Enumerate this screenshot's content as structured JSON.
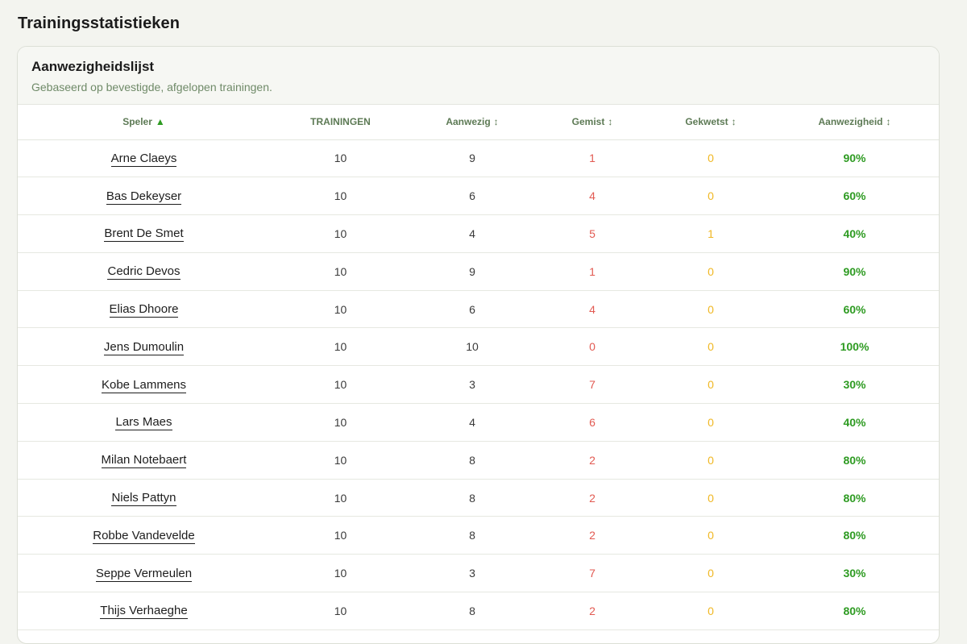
{
  "page": {
    "title": "Trainingsstatistieken"
  },
  "card": {
    "title": "Aanwezigheidslijst",
    "subtitle": "Gebaseerd op bevestigde, afgelopen trainingen."
  },
  "colors": {
    "missed": "#e25a52",
    "injured": "#f0b722",
    "percentage": "#2e9b22",
    "header_text": "#5d7a55"
  },
  "table": {
    "columns": [
      {
        "label": "Speler",
        "sort": "▲",
        "sort_active": true
      },
      {
        "label": "TRAININGEN",
        "sort": "",
        "sort_active": false
      },
      {
        "label": "Aanwezig",
        "sort": "↕",
        "sort_active": false
      },
      {
        "label": "Gemist",
        "sort": "↕",
        "sort_active": false
      },
      {
        "label": "Gekwetst",
        "sort": "↕",
        "sort_active": false
      },
      {
        "label": "Aanwezigheid",
        "sort": "↕",
        "sort_active": false
      }
    ],
    "rows": [
      {
        "player": "Arne Claeys",
        "trainings": "10",
        "present": "9",
        "missed": "1",
        "injured": "0",
        "attendance": "90%"
      },
      {
        "player": "Bas Dekeyser",
        "trainings": "10",
        "present": "6",
        "missed": "4",
        "injured": "0",
        "attendance": "60%"
      },
      {
        "player": "Brent De Smet",
        "trainings": "10",
        "present": "4",
        "missed": "5",
        "injured": "1",
        "attendance": "40%"
      },
      {
        "player": "Cedric Devos",
        "trainings": "10",
        "present": "9",
        "missed": "1",
        "injured": "0",
        "attendance": "90%"
      },
      {
        "player": "Elias Dhoore",
        "trainings": "10",
        "present": "6",
        "missed": "4",
        "injured": "0",
        "attendance": "60%"
      },
      {
        "player": "Jens Dumoulin",
        "trainings": "10",
        "present": "10",
        "missed": "0",
        "injured": "0",
        "attendance": "100%"
      },
      {
        "player": "Kobe Lammens",
        "trainings": "10",
        "present": "3",
        "missed": "7",
        "injured": "0",
        "attendance": "30%"
      },
      {
        "player": "Lars Maes",
        "trainings": "10",
        "present": "4",
        "missed": "6",
        "injured": "0",
        "attendance": "40%"
      },
      {
        "player": "Milan Notebaert",
        "trainings": "10",
        "present": "8",
        "missed": "2",
        "injured": "0",
        "attendance": "80%"
      },
      {
        "player": "Niels Pattyn",
        "trainings": "10",
        "present": "8",
        "missed": "2",
        "injured": "0",
        "attendance": "80%"
      },
      {
        "player": "Robbe Vandevelde",
        "trainings": "10",
        "present": "8",
        "missed": "2",
        "injured": "0",
        "attendance": "80%"
      },
      {
        "player": "Seppe Vermeulen",
        "trainings": "10",
        "present": "3",
        "missed": "7",
        "injured": "0",
        "attendance": "30%"
      },
      {
        "player": "Thijs Verhaeghe",
        "trainings": "10",
        "present": "8",
        "missed": "2",
        "injured": "0",
        "attendance": "80%"
      }
    ]
  }
}
